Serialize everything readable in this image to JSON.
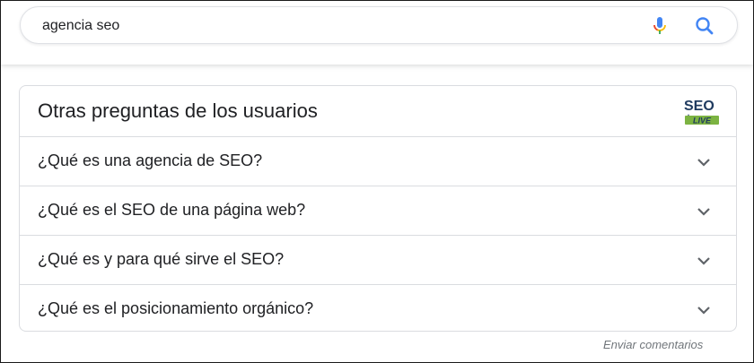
{
  "search": {
    "query": "agencia seo"
  },
  "icons": {
    "mic": "mic-icon",
    "search": "search-icon",
    "expand": "chevron-down-icon"
  },
  "colors": {
    "google_blue": "#4285f4",
    "google_red": "#ea4335",
    "google_yellow": "#fbbc04",
    "google_green": "#34a853",
    "logo_navy": "#1f3a5f",
    "logo_green": "#7cb342"
  },
  "paa": {
    "title": "Otras preguntas de los usuarios",
    "logo": {
      "line1": "SEO",
      "line2": "LIVE"
    },
    "questions": [
      {
        "text": "¿Qué es una agencia de SEO?"
      },
      {
        "text": "¿Qué es el SEO de una página web?"
      },
      {
        "text": "¿Qué es y para qué sirve el SEO?"
      },
      {
        "text": "¿Qué es el posicionamiento orgánico?"
      }
    ]
  },
  "footer": {
    "feedback_label": "Enviar comentarios"
  }
}
